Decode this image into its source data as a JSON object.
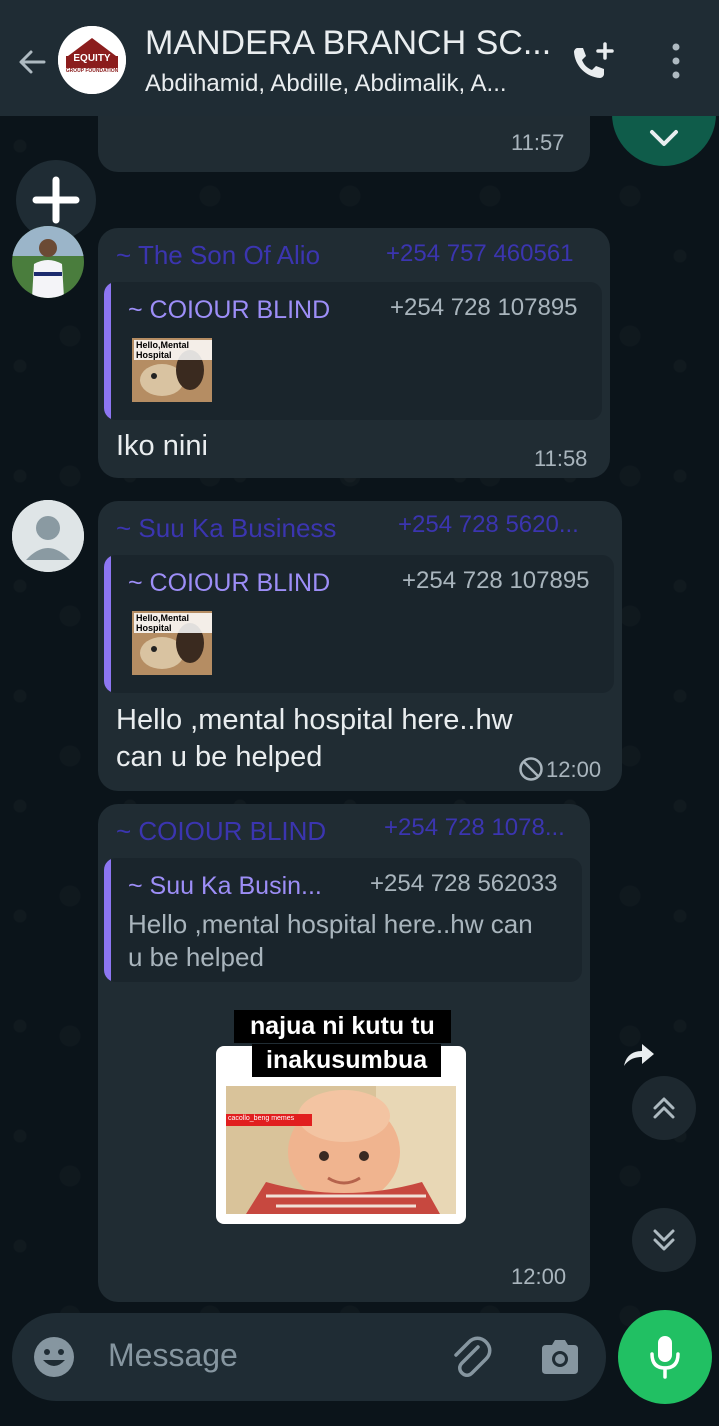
{
  "header": {
    "title": "MANDERA BRANCH SC...",
    "subtitle": "Abdihamid, Abdille, Abdimalik, A...",
    "avatar_text": "EQUITY",
    "avatar_subtext": "GROUP FOUNDATION"
  },
  "messages": [
    {
      "time": "11:57"
    },
    {
      "sender": "~ The Son Of Alio",
      "phone": "+254 757 460561",
      "quote": {
        "name": "~ COIOUR BLIND",
        "phone": "+254 728 107895",
        "image_caption": "Hello,Mental Hospital"
      },
      "text": "Iko nini",
      "time": "11:58"
    },
    {
      "sender": "~ Suu Ka Business",
      "phone": "+254 728 5620...",
      "quote": {
        "name": "~ COIOUR BLIND",
        "phone": "+254 728 107895",
        "image_caption": "Hello,Mental Hospital"
      },
      "text_line1": "Hello ,mental hospital here..hw",
      "text_line2": "can u be helped",
      "time": "12:00"
    },
    {
      "sender": "~ COIOUR BLIND",
      "phone": "+254 728 1078...",
      "quote": {
        "name": "~ Suu Ka Busin...",
        "phone": "+254 728 562033",
        "text_line1": "Hello ,mental hospital here..hw can",
        "text_line2": "u be helped"
      },
      "sticker_line1": "najua ni kutu tu",
      "sticker_line2": "inakusumbua",
      "sticker_watermark": "cacollo_beng memes",
      "time": "12:00"
    }
  ],
  "composer": {
    "placeholder": "Message"
  },
  "colors": {
    "accent": "#21c063",
    "bubble": "#202c33",
    "header": "#1f2c34",
    "quote_bar": "#8d76f2"
  }
}
